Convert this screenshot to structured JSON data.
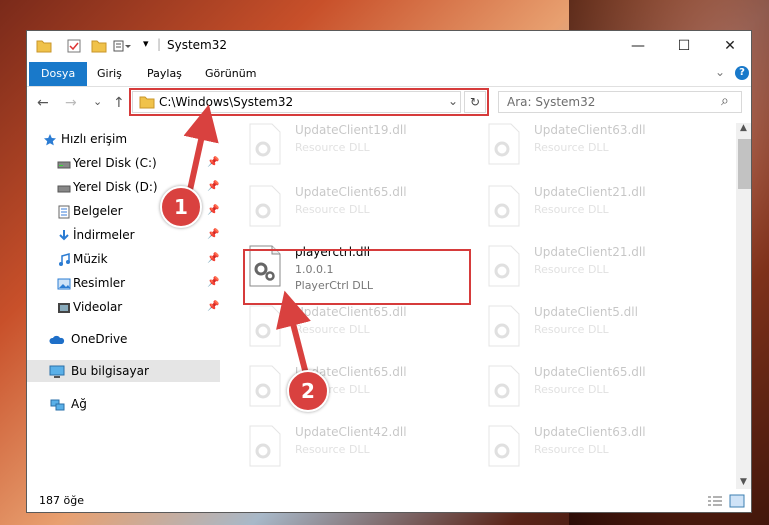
{
  "window": {
    "title": "System32",
    "controls": {
      "minimize": "—",
      "maximize": "☐",
      "close": "✕"
    }
  },
  "ribbon": {
    "tabs": [
      "Dosya",
      "Giriş",
      "Paylaş",
      "Görünüm"
    ],
    "collapse": "⌄",
    "help": "?"
  },
  "nav": {
    "back": "←",
    "forward": "→",
    "recent": "⌄",
    "up": "↑",
    "address": "C:\\Windows\\System32",
    "dropdown": "⌄",
    "refresh": "↻",
    "search_placeholder": "Ara: System32",
    "search_icon": "⌕"
  },
  "sidebar": {
    "items": [
      {
        "label": "Hızlı erişim",
        "icon": "star-icon"
      },
      {
        "label": "Yerel Disk (C:)",
        "icon": "drive-icon",
        "pin": "📌"
      },
      {
        "label": "Yerel Disk (D:)",
        "icon": "drive-icon",
        "pin": "📌"
      },
      {
        "label": "Belgeler",
        "icon": "document-icon",
        "pin": "📌"
      },
      {
        "label": "İndirmeler",
        "icon": "download-icon",
        "pin": "📌"
      },
      {
        "label": "Müzik",
        "icon": "music-icon",
        "pin": "📌"
      },
      {
        "label": "Resimler",
        "icon": "picture-icon",
        "pin": "📌"
      },
      {
        "label": "Videolar",
        "icon": "video-icon",
        "pin": "📌"
      },
      {
        "label": "OneDrive",
        "icon": "cloud-icon"
      },
      {
        "label": "Bu bilgisayar",
        "icon": "computer-icon"
      },
      {
        "label": "Ağ",
        "icon": "network-icon"
      }
    ]
  },
  "files": [
    {
      "name": "UpdateClient19.dll",
      "type": "Resource DLL"
    },
    {
      "name": "UpdateClient63.dll",
      "type": "Resource DLL"
    },
    {
      "name": "UpdateClient65.dll",
      "type": "Resource DLL"
    },
    {
      "name": "UpdateClient21.dll",
      "type": "Resource DLL"
    },
    {
      "name": "playerctrl.dll",
      "version": "1.0.0.1",
      "type": "PlayerCtrl DLL"
    },
    {
      "name": "UpdateClient21.dll",
      "type": "Resource DLL"
    },
    {
      "name": "UpdateClient65.dll",
      "type": "Resource DLL"
    },
    {
      "name": "UpdateClient5.dll",
      "type": "Resource DLL"
    },
    {
      "name": "UpdateClient65.dll",
      "type": "Resource DLL"
    },
    {
      "name": "UpdateClient65.dll",
      "type": "Resource DLL"
    },
    {
      "name": "UpdateClient42.dll",
      "type": "Resource DLL"
    },
    {
      "name": "UpdateClient63.dll",
      "type": "Resource DLL"
    }
  ],
  "status": {
    "count": "187 öğe"
  },
  "markers": {
    "one": "1",
    "two": "2"
  },
  "colors": {
    "accent": "#1979ca",
    "highlight": "#d63b3b"
  }
}
